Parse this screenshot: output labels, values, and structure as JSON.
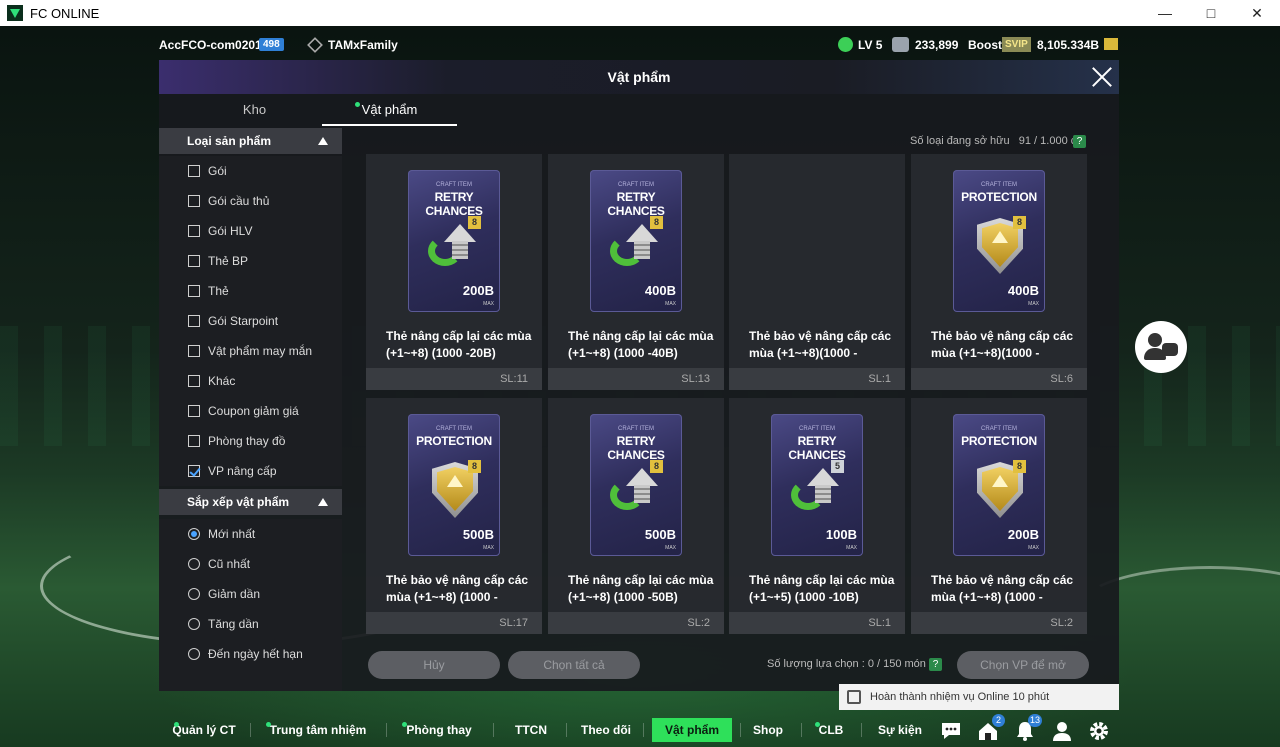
{
  "window": {
    "title": "FC ONLINE",
    "controls": [
      "minimize",
      "maximize",
      "close"
    ]
  },
  "hud": {
    "account": "AccFCO-com0201f",
    "account_badge": "498",
    "family": "TAMxFamily",
    "level": "LV 5",
    "coins": "233,899",
    "boost": "Boost",
    "svip": "SVIP",
    "bp": "8,105.334B"
  },
  "modal": {
    "title": "Vật phẩm",
    "close_icon": "close-icon"
  },
  "tabs": [
    {
      "label": "Kho",
      "active": false
    },
    {
      "label": "Vật phẩm",
      "active": true
    }
  ],
  "filters": {
    "category_title": "Loại sản phẩm",
    "categories": [
      {
        "label": "Gói",
        "checked": false
      },
      {
        "label": "Gói cầu thủ",
        "checked": false
      },
      {
        "label": "Gói HLV",
        "checked": false
      },
      {
        "label": "Thẻ BP",
        "checked": false
      },
      {
        "label": "Thẻ",
        "checked": false
      },
      {
        "label": "Gói Starpoint",
        "checked": false
      },
      {
        "label": "Vật phẩm may mắn",
        "checked": false
      },
      {
        "label": "Khác",
        "checked": false
      },
      {
        "label": "Coupon giảm giá",
        "checked": false
      },
      {
        "label": "Phòng thay đồ",
        "checked": false
      },
      {
        "label": "VP nâng cấp",
        "checked": true
      }
    ],
    "sort_title": "Sắp xếp vật phẩm",
    "sorts": [
      {
        "label": "Mới nhất",
        "checked": true
      },
      {
        "label": "Cũ nhất",
        "checked": false
      },
      {
        "label": "Giảm dần",
        "checked": false
      },
      {
        "label": "Tăng dần",
        "checked": false
      },
      {
        "label": "Đến ngày hết hạn",
        "checked": false
      }
    ]
  },
  "owned": {
    "label": "Số loại đang sở hữu",
    "value": "91 / 1.000 cái",
    "help": "?"
  },
  "items": [
    {
      "kind": "retry",
      "craft": "CRAFT ITEM",
      "type": "RETRY CHANCES",
      "level": "8",
      "price": "200B",
      "max": "MAX",
      "name": "Thẻ nâng cấp lại các mùa (+1~+8) (1000 -20B)",
      "qty": "SL:11"
    },
    {
      "kind": "retry",
      "craft": "CRAFT ITEM",
      "type": "RETRY CHANCES",
      "level": "8",
      "price": "400B",
      "max": "MAX",
      "name": "Thẻ nâng cấp lại các mùa (+1~+8) (1000 -40B)",
      "qty": "SL:13"
    },
    {
      "kind": "empty",
      "craft": "",
      "type": "",
      "level": "",
      "price": "",
      "max": "",
      "name": "Thẻ bảo vệ nâng cấp các mùa (+1~+8)(1000 -",
      "qty": "SL:1"
    },
    {
      "kind": "protect",
      "craft": "CRAFT ITEM",
      "type": "PROTECTION",
      "level": "8",
      "price": "400B",
      "max": "MAX",
      "name": "Thẻ bảo vệ nâng cấp các mùa (+1~+8)(1000 -",
      "qty": "SL:6"
    },
    {
      "kind": "protect",
      "craft": "CRAFT ITEM",
      "type": "PROTECTION",
      "level": "8",
      "price": "500B",
      "max": "MAX",
      "name": "Thẻ bảo vệ nâng cấp các mùa (+1~+8) (1000 -",
      "qty": "SL:17"
    },
    {
      "kind": "retry",
      "craft": "CRAFT ITEM",
      "type": "RETRY CHANCES",
      "level": "8",
      "price": "500B",
      "max": "MAX",
      "name": "Thẻ nâng cấp lại các mùa (+1~+8) (1000 -50B)",
      "qty": "SL:2"
    },
    {
      "kind": "retry",
      "craft": "CRAFT ITEM",
      "type": "RETRY CHANCES",
      "level": "5",
      "price": "100B",
      "max": "MAX",
      "name": "Thẻ nâng cấp lại các mùa (+1~+5) (1000 -10B)",
      "qty": "SL:1"
    },
    {
      "kind": "protect",
      "craft": "CRAFT ITEM",
      "type": "PROTECTION",
      "level": "8",
      "price": "200B",
      "max": "MAX",
      "name": "Thẻ bảo vệ nâng cấp các mùa (+1~+8) (1000 -",
      "qty": "SL:2"
    }
  ],
  "actions": {
    "cancel": "Hủy",
    "select_all": "Chọn tất cả",
    "selected_label": "Số lượng lựa chọn : 0 / 150 món",
    "help": "?",
    "choose": "Chọn VP để mở"
  },
  "notice": "Hoàn thành nhiệm vụ Online 10 phút",
  "nav": [
    {
      "label": "Quản lý CT",
      "dot": true,
      "active": false
    },
    {
      "label": "Trung tâm nhiệm vụ",
      "dot": true,
      "active": false
    },
    {
      "label": "Phòng thay đồ",
      "dot": true,
      "active": false
    },
    {
      "label": "TTCN",
      "dot": false,
      "active": false
    },
    {
      "label": "Theo dõi",
      "dot": false,
      "active": false
    },
    {
      "label": "Vật phẩm",
      "dot": false,
      "active": true
    },
    {
      "label": "Shop",
      "dot": false,
      "active": false
    },
    {
      "label": "CLB",
      "dot": true,
      "active": false
    },
    {
      "label": "Sự kiện",
      "dot": false,
      "active": false
    }
  ],
  "nav_icons": [
    {
      "name": "chat-icon",
      "badge": ""
    },
    {
      "name": "home-icon",
      "badge": "2"
    },
    {
      "name": "bell-icon",
      "badge": "13"
    },
    {
      "name": "profile-icon",
      "badge": ""
    },
    {
      "name": "settings-icon",
      "badge": ""
    }
  ],
  "colors": {
    "accent": "#2ee05a",
    "info": "#2f7fd6",
    "modal_bg": "#1a1c20"
  }
}
